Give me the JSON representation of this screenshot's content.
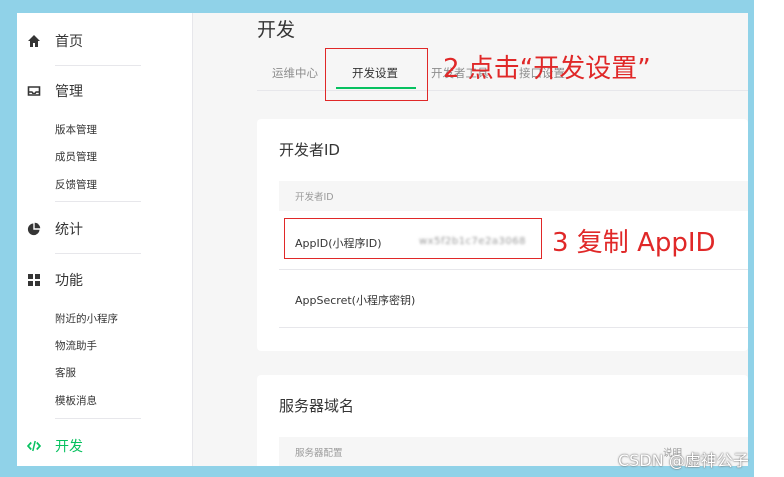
{
  "sidebar": {
    "home": {
      "label": "首页",
      "icon": "home-icon"
    },
    "manage": {
      "label": "管理",
      "icon": "inbox-icon",
      "items": [
        "版本管理",
        "成员管理",
        "反馈管理"
      ]
    },
    "stats": {
      "label": "统计",
      "icon": "pie-chart-icon"
    },
    "features": {
      "label": "功能",
      "icon": "grid-icon",
      "items": [
        "附近的小程序",
        "物流助手",
        "客服",
        "模板消息"
      ]
    },
    "develop": {
      "label": "开发",
      "icon": "code-icon",
      "active": true
    }
  },
  "main": {
    "title": "开发",
    "tabs": [
      {
        "label": "运维中心",
        "active": false
      },
      {
        "label": "开发设置",
        "active": true
      },
      {
        "label": "开发者工具",
        "active": false
      },
      {
        "label": "接口设置",
        "active": false
      }
    ],
    "developer_id_card": {
      "title": "开发者ID",
      "table_header": "开发者ID",
      "rows": [
        {
          "key": "AppID(小程序ID)",
          "value": "wx5f2b1c7e2a3068"
        },
        {
          "key": "AppSecret(小程序密钥)",
          "value": ""
        }
      ]
    },
    "server_domain_card": {
      "title": "服务器域名",
      "table_header": "服务器配置",
      "table_header_right": "说明"
    }
  },
  "annotations": {
    "step2": "2 点击“开发设置”",
    "step3": "3 复制 AppID",
    "color": "#e02828"
  },
  "watermark": "CSDN @虚神公子",
  "colors": {
    "accent": "#07c160",
    "frame": "#90d2e8",
    "background": "#f6f6f6"
  }
}
